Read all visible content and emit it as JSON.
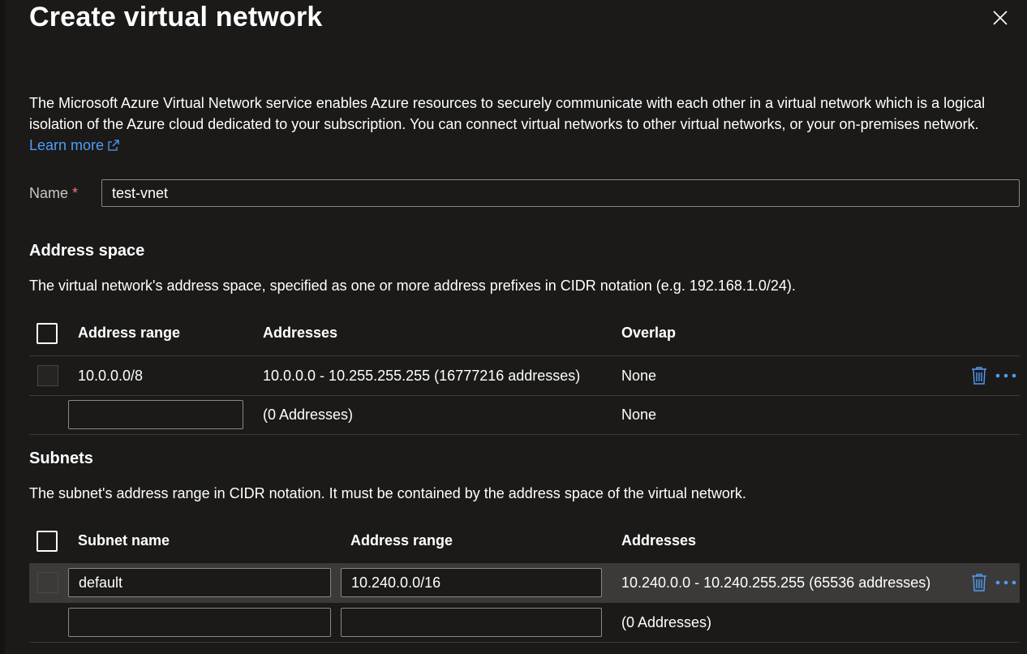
{
  "panel": {
    "title": "Create virtual network",
    "description": "The Microsoft Azure Virtual Network service enables Azure resources to securely communicate with each other in a virtual network which is a logical isolation of the Azure cloud dedicated to your subscription. You can connect virtual networks to other virtual networks, or your on-premises network.",
    "learn_more": "Learn more"
  },
  "name_field": {
    "label": "Name",
    "required_mark": "*",
    "value": "test-vnet"
  },
  "address_space": {
    "heading": "Address space",
    "description": "The virtual network's address space, specified as one or more address prefixes in CIDR notation (e.g. 192.168.1.0/24).",
    "columns": [
      "Address range",
      "Addresses",
      "Overlap"
    ],
    "rows": [
      {
        "range": "10.0.0.0/8",
        "addresses": "10.0.0.0 - 10.255.255.255 (16777216 addresses)",
        "overlap": "None"
      }
    ],
    "new_row": {
      "addresses": "(0 Addresses)",
      "overlap": "None"
    }
  },
  "subnets": {
    "heading": "Subnets",
    "description": "The subnet's address range in CIDR notation. It must be contained by the address space of the virtual network.",
    "columns": [
      "Subnet name",
      "Address range",
      "Addresses"
    ],
    "rows": [
      {
        "name": "default",
        "range": "10.240.0.0/16",
        "addresses": "10.240.0.0 - 10.240.255.255 (65536 addresses)"
      }
    ],
    "new_row": {
      "addresses": "(0 Addresses)"
    }
  },
  "icons": {
    "close": "close-icon",
    "external_link": "external-link-icon",
    "delete": "trash-icon",
    "more": "more-icon"
  },
  "colors": {
    "background": "#1b1a19",
    "link": "#4f9df7",
    "required": "#f1707b",
    "selected_row": "#3b3a39"
  }
}
